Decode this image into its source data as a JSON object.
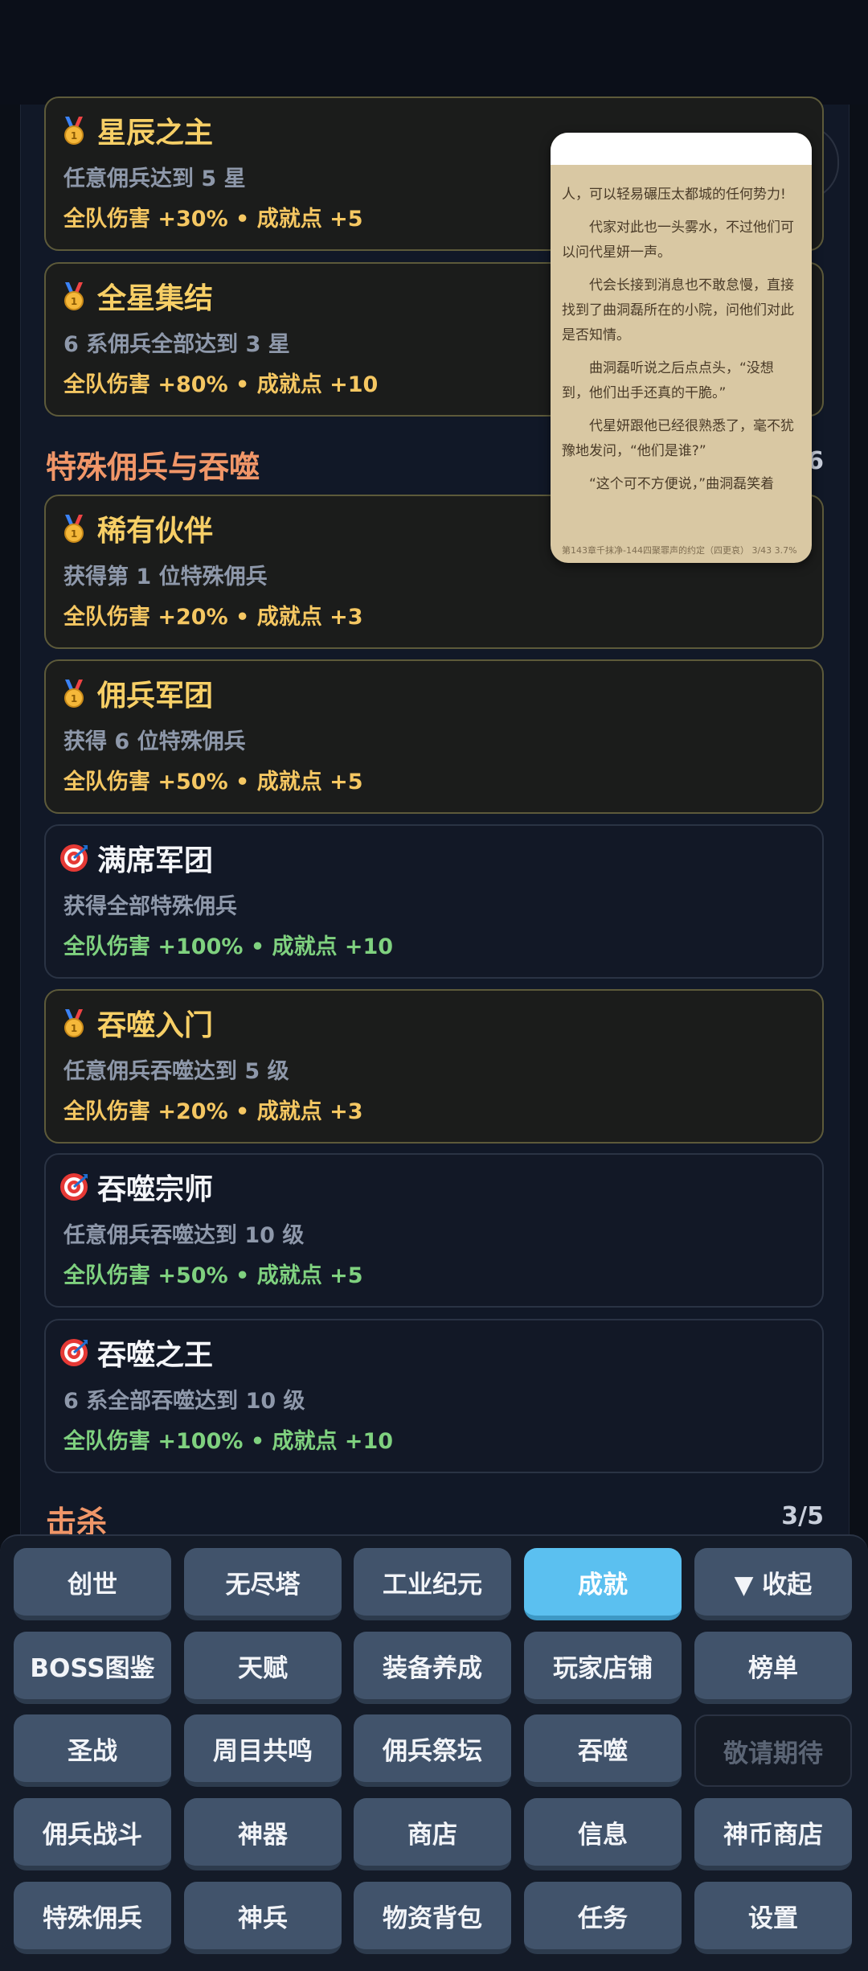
{
  "achievements_top": [
    {
      "title": "星辰之主",
      "desc": "任意佣兵达到 5 星",
      "reward": "全队伤害 +30% • 成就点 +5",
      "icon": "medal-icon",
      "style": "gold"
    },
    {
      "title": "全星集结",
      "desc": "6 系佣兵全部达到 3 星",
      "reward": "全队伤害 +80% • 成就点 +10",
      "icon": "medal-icon",
      "style": "gold"
    }
  ],
  "section_special": {
    "title": "特殊佣兵与吞噬",
    "count": "6"
  },
  "achievements_special": [
    {
      "title": "稀有伙伴",
      "desc": "获得第 1 位特殊佣兵",
      "reward": "全队伤害 +20% • 成就点 +3",
      "icon": "medal-icon",
      "style": "gold"
    },
    {
      "title": "佣兵军团",
      "desc": "获得 6 位特殊佣兵",
      "reward": "全队伤害 +50% • 成就点 +5",
      "icon": "medal-icon",
      "style": "gold"
    },
    {
      "title": "满席军团",
      "desc": "获得全部特殊佣兵",
      "reward": "全队伤害 +100% • 成就点 +10",
      "icon": "target-icon",
      "style": "blue"
    },
    {
      "title": "吞噬入门",
      "desc": "任意佣兵吞噬达到 5 级",
      "reward": "全队伤害 +20% • 成就点 +3",
      "icon": "medal-icon",
      "style": "gold"
    },
    {
      "title": "吞噬宗师",
      "desc": "任意佣兵吞噬达到 10 级",
      "reward": "全队伤害 +50% • 成就点 +5",
      "icon": "target-icon",
      "style": "blue"
    },
    {
      "title": "吞噬之王",
      "desc": "6 系全部吞噬达到 10 级",
      "reward": "全队伤害 +100% • 成就点 +10",
      "icon": "target-icon",
      "style": "blue"
    }
  ],
  "section_kill": {
    "title": "击杀",
    "count": "3/5"
  },
  "reader": {
    "paragraphs": [
      "人，可以轻易碾压太都城的任何势力!",
      "代家对此也一头雾水，不过他们可以问代星妍一声。",
      "代会长接到消息也不敢怠慢，直接找到了曲洞磊所在的小院，问他们对此是否知情。",
      "曲洞磊听说之后点点头，“没想到，他们出手还真的干脆。”",
      "代星妍跟他已经很熟悉了，毫不犹豫地发问，“他们是谁?”",
      "“这个可不方便说，”曲洞磊笑着"
    ],
    "footer": "第143章千抹净-144四聚罪声的约定（四更哀）    3/43    3.7%"
  },
  "menu": [
    [
      "创世",
      "无尽塔",
      "工业纪元",
      "成就",
      "▼ 收起"
    ],
    [
      "BOSS图鉴",
      "天赋",
      "装备养成",
      "玩家店铺",
      "榜单"
    ],
    [
      "圣战",
      "周目共鸣",
      "佣兵祭坛",
      "吞噬",
      "敬请期待"
    ],
    [
      "佣兵战斗",
      "神器",
      "商店",
      "信息",
      "神币商店"
    ],
    [
      "特殊佣兵",
      "神兵",
      "物资背包",
      "任务",
      "设置"
    ]
  ],
  "menu_active": "成就",
  "menu_disabled": "敬请期待"
}
